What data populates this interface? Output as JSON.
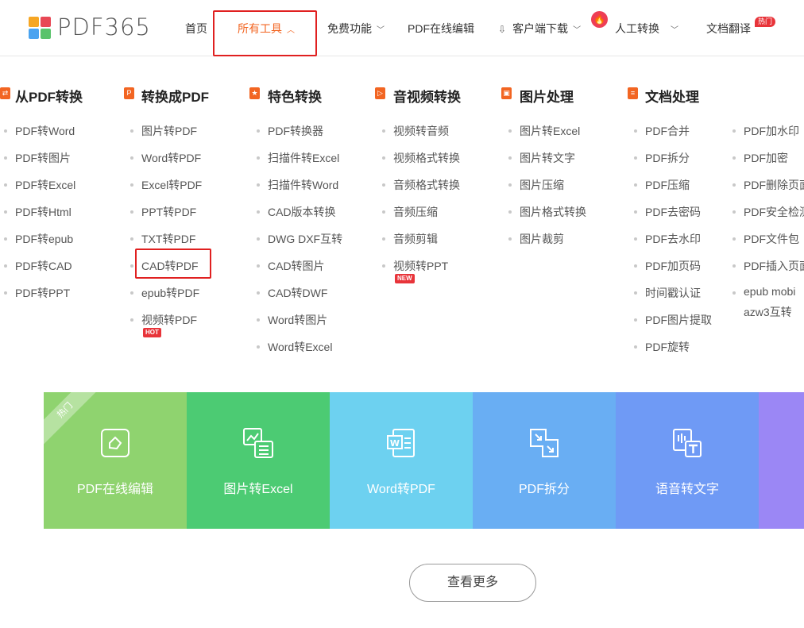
{
  "brand": {
    "name": "PDF365"
  },
  "nav": {
    "home": "首页",
    "all_tools": "所有工具",
    "free": "免费功能",
    "online_edit": "PDF在线编辑",
    "download": "客户端下载",
    "manual": "人工转换",
    "translate": "文档翻译",
    "hot_badge": "热门"
  },
  "categories": [
    {
      "title": "从PDF转换",
      "items": [
        "PDF转Word",
        "PDF转图片",
        "PDF转Excel",
        "PDF转Html",
        "PDF转epub",
        "PDF转CAD",
        "PDF转PPT"
      ]
    },
    {
      "title": "转换成PDF",
      "items": [
        "图片转PDF",
        "Word转PDF",
        "Excel转PDF",
        "PPT转PDF",
        "TXT转PDF",
        "CAD转PDF",
        "epub转PDF",
        "视频转PDF"
      ],
      "tag": "HOT"
    },
    {
      "title": "特色转换",
      "items": [
        "PDF转换器",
        "扫描件转Excel",
        "扫描件转Word",
        "CAD版本转换",
        "DWG DXF互转",
        "CAD转图片",
        "CAD转DWF",
        "Word转图片",
        "Word转Excel"
      ]
    },
    {
      "title": "音视频转换",
      "items": [
        "视频转音频",
        "视频格式转换",
        "音频格式转换",
        "音频压缩",
        "音频剪辑",
        "视频转PPT"
      ],
      "tag": "NEW"
    },
    {
      "title": "图片处理",
      "items": [
        "图片转Excel",
        "图片转文字",
        "图片压缩",
        "图片格式转换",
        "图片裁剪"
      ]
    },
    {
      "title": "文档处理",
      "items": [
        "PDF合并",
        "PDF拆分",
        "PDF压缩",
        "PDF去密码",
        "PDF去水印",
        "PDF加页码",
        "时间戳认证",
        "PDF图片提取",
        "PDF旋转"
      ],
      "items_col2": [
        "PDF加水印",
        "PDF加密",
        "PDF删除页面",
        "PDF安全检测",
        "PDF文件包",
        "PDF插入页面",
        "epub mobi",
        "azw3互转"
      ]
    }
  ],
  "tiles": [
    {
      "label": "PDF在线编辑",
      "color": "#8fd36f",
      "ribbon": "热门"
    },
    {
      "label": "图片转Excel",
      "color": "#4ccb73"
    },
    {
      "label": "Word转PDF",
      "color": "#6dd1f0"
    },
    {
      "label": "PDF拆分",
      "color": "#69aef3"
    },
    {
      "label": "语音转文字",
      "color": "#6f9af5"
    }
  ],
  "more_button": "查看更多",
  "colors": {
    "accent": "#f26522",
    "highlight_box": "#e02020"
  }
}
